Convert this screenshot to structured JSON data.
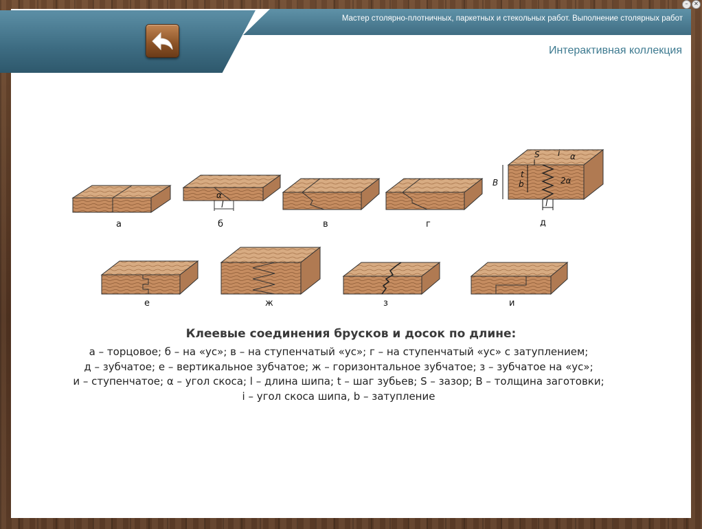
{
  "header": {
    "course_title": "Мастер столярно-плотничных, паркетных и стекольных работ. Выполнение столярных работ",
    "collection_title": "Интерактивная коллекция"
  },
  "figure": {
    "labels": [
      "а",
      "б",
      "в",
      "г",
      "д",
      "е",
      "ж",
      "з",
      "и"
    ],
    "dim_alpha": "α",
    "dim_l": "l",
    "dim_S": "S",
    "dim_i": "i",
    "dim_B": "B",
    "dim_b": "b",
    "dim_t": "t",
    "dim_2alpha": "2α"
  },
  "caption": {
    "title": "Клеевые соединения брусков и досок по длине:",
    "lines": [
      "а – торцовое; б – на «ус»; в – на ступенчатый «ус»; г – на ступенчатый «ус» с затуплением;",
      "д – зубчатое; е – вертикальное зубчатое; ж – горизонтальное зубчатое; з – зубчатое на «ус»;",
      "и – ступенчатое; α – угол скоса; l – длина шипа; t – шаг зубьев; S – зазор; B – толщина заготовки;",
      "i – угол скоса шипа, b – затупление"
    ]
  },
  "colors": {
    "header": "#3f6d83",
    "accent_text": "#3d7a90",
    "wood_top": "#d9b08a",
    "wood_front": "#c48d63"
  },
  "icons": {
    "back": "back-arrow-icon",
    "minimize": "minimize-icon",
    "close": "close-icon"
  }
}
